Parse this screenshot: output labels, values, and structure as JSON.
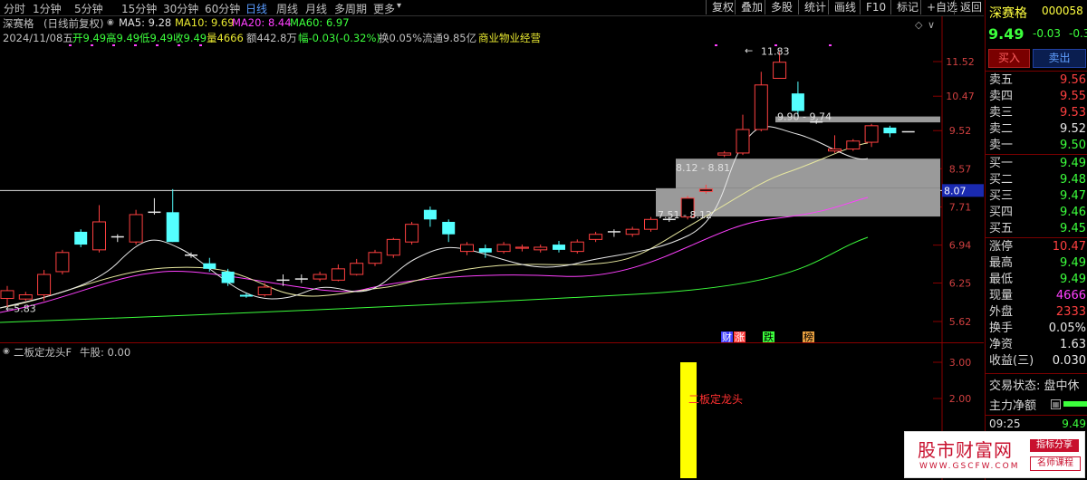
{
  "toolbar": {
    "timeframes": [
      "分时",
      "1分钟",
      "5分钟",
      "15分钟",
      "30分钟",
      "60分钟",
      "日线",
      "周线",
      "月线",
      "多周期",
      "更多"
    ],
    "active_timeframe": "日线",
    "more_arrow": "▾",
    "buttons": [
      "复权",
      "叠加",
      "多股",
      "统计",
      "画线",
      "F10",
      "标记",
      "+自选",
      "返回"
    ]
  },
  "header": {
    "name": "深赛格",
    "adjust": "(日线前复权)",
    "ma5": "MA5: 9.28",
    "ma10": "MA10: 9.69",
    "ma20": "MA20: 8.44",
    "ma60": "MA60: 6.97",
    "date": "2024/11/08五",
    "open": "开9.49",
    "high": "高9.49",
    "low": "低9.49",
    "close": "收9.49",
    "vol": "量4666",
    "amount": "额442.8万",
    "change": "幅-0.03(-0.32%)",
    "turnover": "换0.05%",
    "float": "流通9.85亿",
    "industry": "商业物业经营"
  },
  "chart_data": {
    "type": "candlestick",
    "y_ticks": [
      "11.52",
      "10.47",
      "9.52",
      "8.57",
      "7.71",
      "6.94",
      "6.25",
      "5.62"
    ],
    "current_price_tag": "8.07",
    "annotations": {
      "high_label": "11.83",
      "low_label": "5.83",
      "box1_label": "9.90 - 9.74",
      "box2_label": "8.12 - 8.81",
      "box3_label": "7.51 - 8.12"
    },
    "event_markers": [
      "财",
      "涨",
      "跌",
      "榜"
    ],
    "candles": [
      [
        5.99,
        6.12,
        5.85,
        6.2
      ],
      [
        5.98,
        6.05,
        5.95,
        6.1
      ],
      [
        6.05,
        6.4,
        5.95,
        6.48
      ],
      [
        6.45,
        6.8,
        6.4,
        6.85
      ],
      [
        7.2,
        6.95,
        6.9,
        7.25
      ],
      [
        6.85,
        7.4,
        6.8,
        7.75
      ],
      [
        7.1,
        7.1,
        7.0,
        7.15
      ],
      [
        7.0,
        7.55,
        6.95,
        7.65
      ],
      [
        7.6,
        7.6,
        7.55,
        7.9
      ],
      [
        7.6,
        7.0,
        7.0,
        8.1
      ],
      [
        6.75,
        6.75,
        6.7,
        6.8
      ],
      [
        6.6,
        6.5,
        6.45,
        6.7
      ],
      [
        6.45,
        6.25,
        6.2,
        6.5
      ],
      [
        6.05,
        6.02,
        6.0,
        6.08
      ],
      [
        6.05,
        6.18,
        6.02,
        6.25
      ],
      [
        6.3,
        6.3,
        6.2,
        6.4
      ],
      [
        6.32,
        6.32,
        6.25,
        6.4
      ],
      [
        6.32,
        6.4,
        6.28,
        6.45
      ],
      [
        6.3,
        6.5,
        6.28,
        6.58
      ],
      [
        6.4,
        6.6,
        6.38,
        6.68
      ],
      [
        6.6,
        6.8,
        6.55,
        6.85
      ],
      [
        6.75,
        7.05,
        6.7,
        7.08
      ],
      [
        7.0,
        7.35,
        6.95,
        7.4
      ],
      [
        7.65,
        7.45,
        7.3,
        7.72
      ],
      [
        7.4,
        7.15,
        7.0,
        7.45
      ],
      [
        6.82,
        6.95,
        6.75,
        7.0
      ],
      [
        6.88,
        6.8,
        6.7,
        6.95
      ],
      [
        6.82,
        6.95,
        6.78,
        7.0
      ],
      [
        6.88,
        6.9,
        6.82,
        6.95
      ],
      [
        6.85,
        6.9,
        6.8,
        6.95
      ],
      [
        6.95,
        6.85,
        6.8,
        7.02
      ],
      [
        6.82,
        7.0,
        6.78,
        7.05
      ],
      [
        7.05,
        7.15,
        7.0,
        7.2
      ],
      [
        7.2,
        7.2,
        7.1,
        7.25
      ],
      [
        7.15,
        7.25,
        7.1,
        7.3
      ],
      [
        7.25,
        7.45,
        7.2,
        7.5
      ],
      [
        7.45,
        7.45,
        7.4,
        7.5
      ],
      [
        7.5,
        7.9,
        7.45,
        7.95
      ],
      [
        8.05,
        8.1,
        8.0,
        8.2
      ],
      [
        8.9,
        8.95,
        8.85,
        9.0
      ],
      [
        8.95,
        9.55,
        8.9,
        9.95
      ],
      [
        9.55,
        10.8,
        9.5,
        11.2
      ],
      [
        11.0,
        11.5,
        11.0,
        11.83
      ],
      [
        10.55,
        10.05,
        9.9,
        10.9
      ],
      [
        9.75,
        9.75,
        9.7,
        9.8
      ],
      [
        9.0,
        9.05,
        8.95,
        9.4
      ],
      [
        9.05,
        9.25,
        9.0,
        9.3
      ],
      [
        9.22,
        9.65,
        9.1,
        9.7
      ],
      [
        9.6,
        9.45,
        9.35,
        9.65
      ],
      [
        9.49,
        9.49,
        9.49,
        9.49
      ]
    ],
    "indicator": {
      "name": "二板定龙头F",
      "series_label": "牛股: 0.00",
      "bar_label": "二板定龙头",
      "y_ticks": [
        "3.00",
        "2.00"
      ]
    }
  },
  "panel": {
    "code_name": "深赛格",
    "code": "000058",
    "price": "9.49",
    "change": "-0.03",
    "change_pct": "-0.3",
    "buy": "买入",
    "sell": "卖出",
    "asks": [
      {
        "label": "卖五",
        "price": "9.56"
      },
      {
        "label": "卖四",
        "price": "9.55"
      },
      {
        "label": "卖三",
        "price": "9.53"
      },
      {
        "label": "卖二",
        "price": "9.52"
      },
      {
        "label": "卖一",
        "price": "9.50"
      }
    ],
    "bids": [
      {
        "label": "买一",
        "price": "9.49"
      },
      {
        "label": "买二",
        "price": "9.48"
      },
      {
        "label": "买三",
        "price": "9.47"
      },
      {
        "label": "买四",
        "price": "9.46"
      },
      {
        "label": "买五",
        "price": "9.45"
      }
    ],
    "stats": [
      {
        "label": "涨停",
        "value": "10.47"
      },
      {
        "label": "最高",
        "value": "9.49"
      },
      {
        "label": "最低",
        "value": "9.49"
      },
      {
        "label": "现量",
        "value": "4666"
      },
      {
        "label": "外盘",
        "value": "2333"
      },
      {
        "label": "换手",
        "value": "0.05%"
      },
      {
        "label": "净资",
        "value": "1.63"
      },
      {
        "label": "收益(三)",
        "value": "0.030"
      }
    ],
    "status": "交易状态: 盘中休",
    "flow_label": "主力净额",
    "time": "09:25",
    "time_price": "9.49"
  },
  "watermark": {
    "title": "股市财富网",
    "url": "WWW.GSCFW.COM",
    "tag1": "指标分享",
    "tag2": "名师课程"
  }
}
